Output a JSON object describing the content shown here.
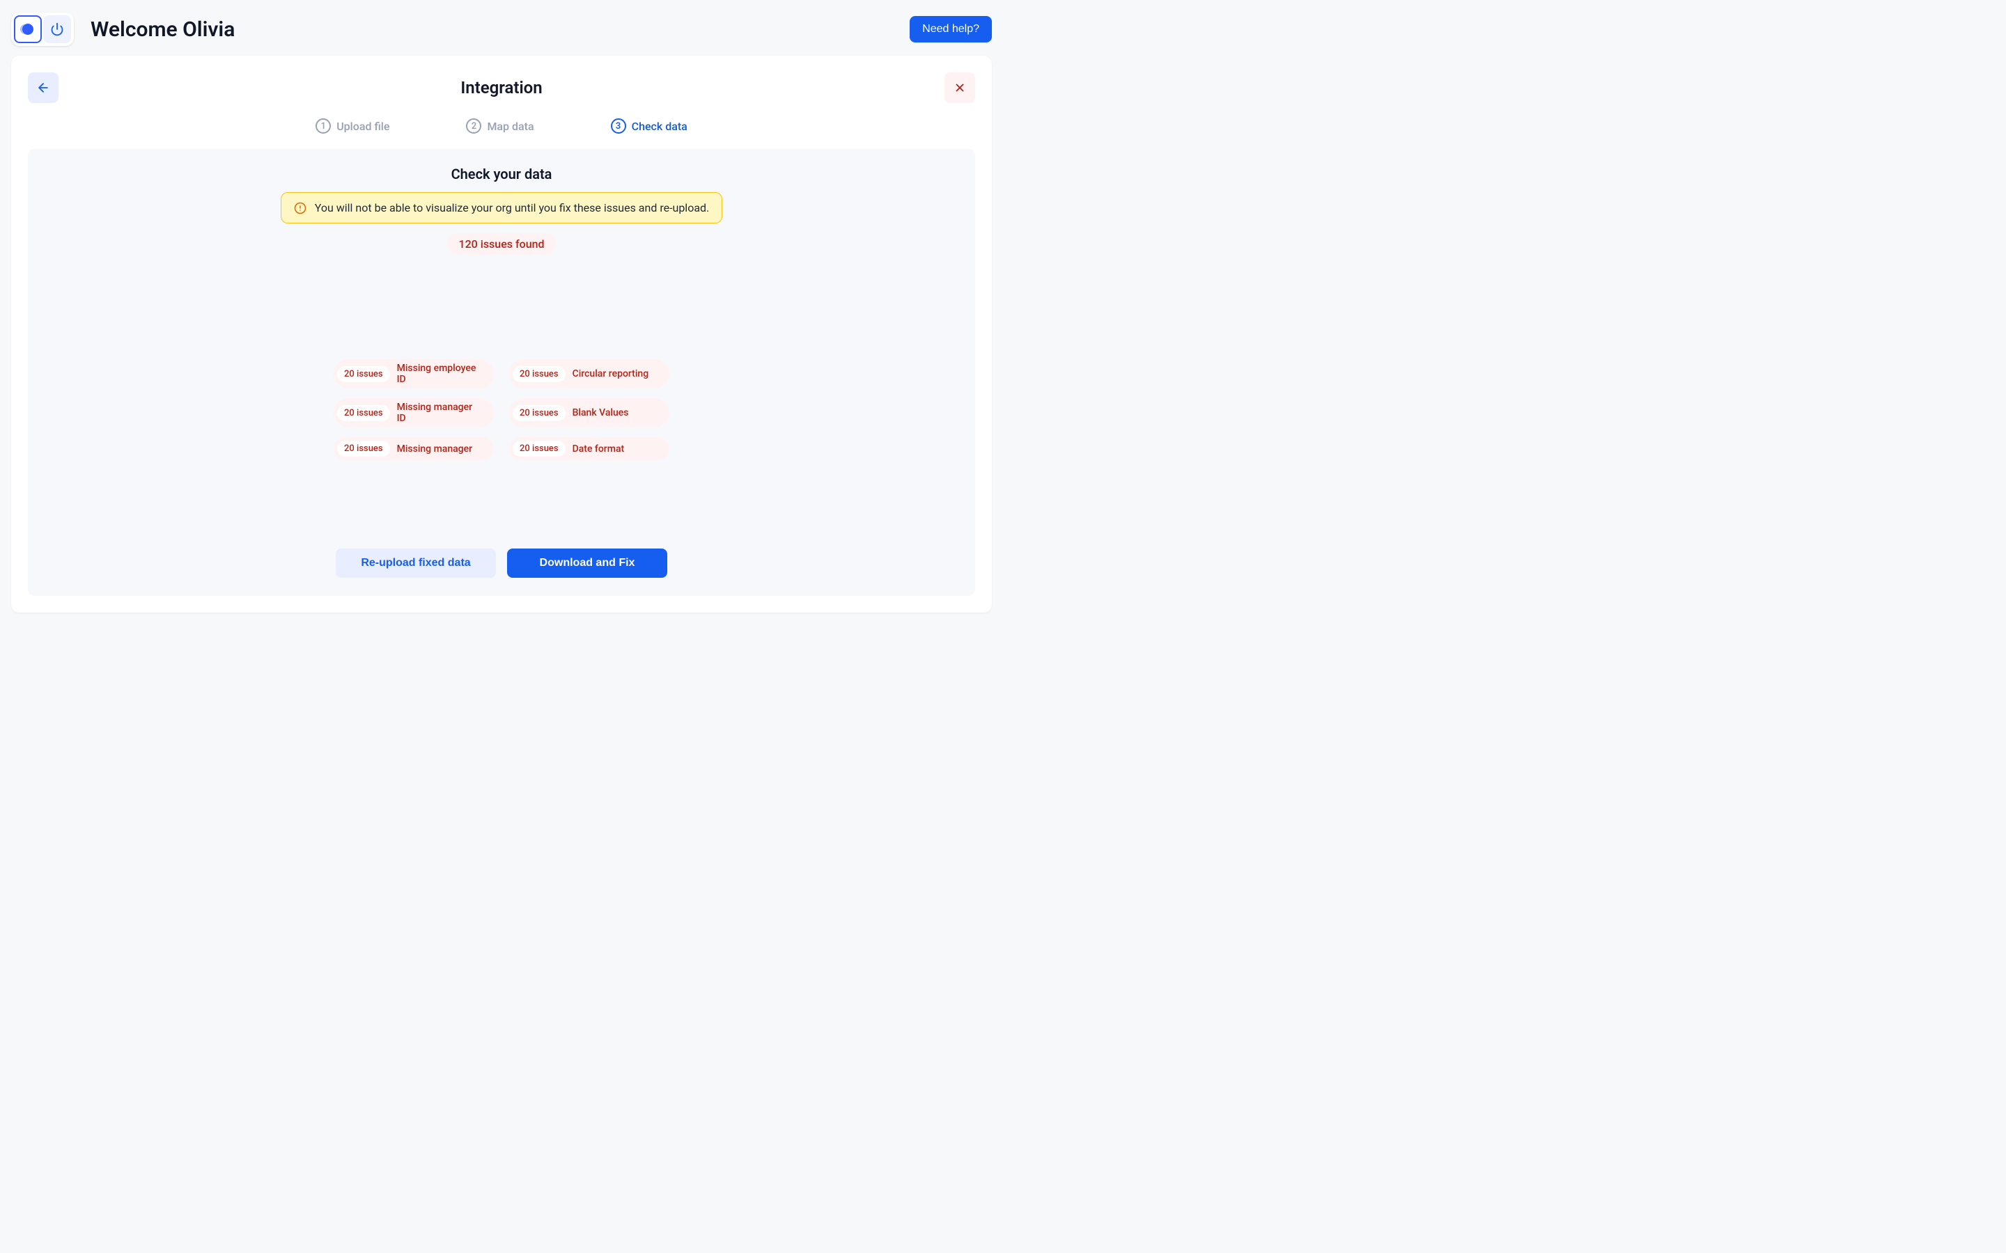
{
  "header": {
    "welcome": "Welcome Olivia",
    "help_button": "Need help?"
  },
  "card": {
    "title": "Integration"
  },
  "steps": [
    {
      "num": "1",
      "label": "Upload file",
      "active": false
    },
    {
      "num": "2",
      "label": "Map data",
      "active": false
    },
    {
      "num": "3",
      "label": "Check data",
      "active": true
    }
  ],
  "panel": {
    "title": "Check your data",
    "alert": "You will not be able to visualize your org until you fix these issues and re-upload.",
    "issues_total": "120 issues found"
  },
  "issues": [
    {
      "count": "20 issues",
      "label": "Missing employee ID"
    },
    {
      "count": "20 issues",
      "label": "Missing manager ID"
    },
    {
      "count": "20 issues",
      "label": "Missing manager"
    },
    {
      "count": "20 issues",
      "label": "Circular reporting"
    },
    {
      "count": "20 issues",
      "label": "Blank Values"
    },
    {
      "count": "20 issues",
      "label": "Date format"
    }
  ],
  "actions": {
    "reupload": "Re-upload fixed data",
    "download": "Download and Fix"
  },
  "chart_data": {
    "type": "pie",
    "title": "",
    "categories": [
      "Missing employee ID",
      "Missing manager ID",
      "Missing manager",
      "Circular reporting",
      "Blank Values",
      "Date format"
    ],
    "values": [
      20,
      20,
      20,
      20,
      20,
      20
    ],
    "total": 120
  }
}
